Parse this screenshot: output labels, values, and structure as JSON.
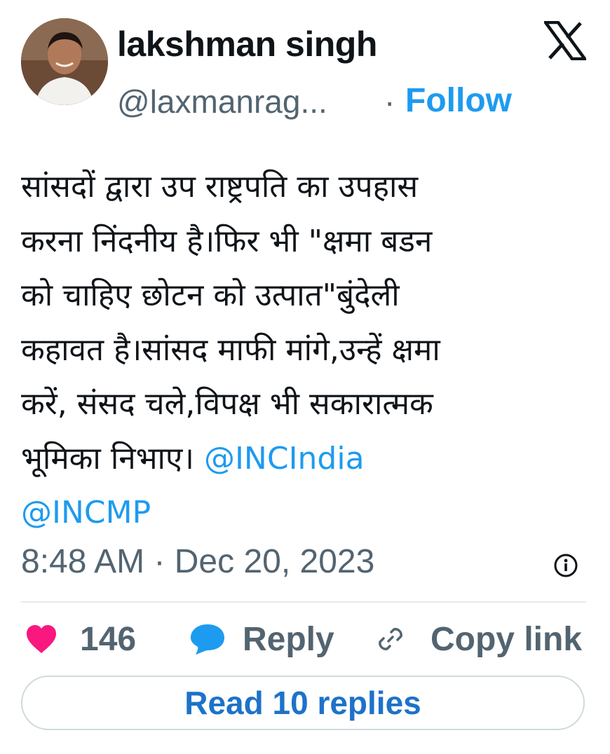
{
  "author": {
    "name": "lakshman singh",
    "handle": "@laxmanrag...",
    "separator": "·",
    "follow_label": "Follow"
  },
  "logo_icon": "x-logo-icon",
  "tweet": {
    "text_lines": [
      "सांसदों द्वारा उप राष्ट्रपति का उपहास",
      "करना निंदनीय है।फिर भी \"क्षमा बडन",
      "को चाहिए छोटन को उत्पात\"बुंदेली",
      "कहावत है।सांसद माफी मांगे,उन्हें क्षमा",
      "करें, संसद चले,विपक्ष भी सकारात्मक",
      "भूमिका निभाए। "
    ],
    "mention_1": "@INCIndia",
    "mention_2": "@INCMP",
    "timestamp": "8:48 AM · Dec 20, 2023"
  },
  "actions": {
    "like_count": "146",
    "reply_label": "Reply",
    "copy_link_label": "Copy link"
  },
  "read_replies_label": "Read 10 replies",
  "colors": {
    "accent": "#1d9bf0",
    "like": "#f91880",
    "reply_icon": "#1d9bf0",
    "muted": "#536471"
  },
  "icons": [
    "info-icon",
    "heart-icon",
    "speech-bubble-icon",
    "link-icon"
  ]
}
